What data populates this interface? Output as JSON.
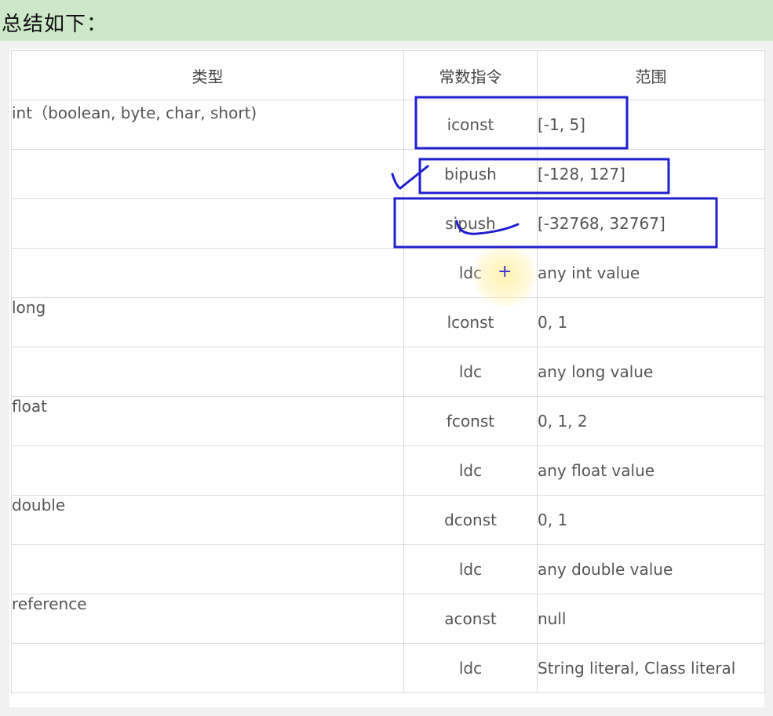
{
  "heading": {
    "text": "总结如下："
  },
  "table": {
    "headers": [
      "类型",
      "常数指令",
      "范围"
    ],
    "rows": [
      [
        "int（boolean, byte, char, short)",
        "iconst",
        "[-1, 5]"
      ],
      [
        "",
        "bipush",
        "[-128, 127]"
      ],
      [
        "",
        "sipush",
        "[-32768, 32767]"
      ],
      [
        "",
        "ldc",
        "any int value"
      ],
      [
        "long",
        "lconst",
        "0, 1"
      ],
      [
        "",
        "ldc",
        "any long value"
      ],
      [
        "float",
        "fconst",
        "0, 1, 2"
      ],
      [
        "",
        "ldc",
        "any float value"
      ],
      [
        "double",
        "dconst",
        "0, 1"
      ],
      [
        "",
        "ldc",
        "any double value"
      ],
      [
        "reference",
        "aconst",
        "null"
      ],
      [
        "",
        "ldc",
        "String literal, Class literal"
      ]
    ]
  },
  "annotations": {
    "pen_color": "#1f1fd0",
    "heading_bar_color": "#cde8c8",
    "cursor_icon": "plus-cursor"
  }
}
